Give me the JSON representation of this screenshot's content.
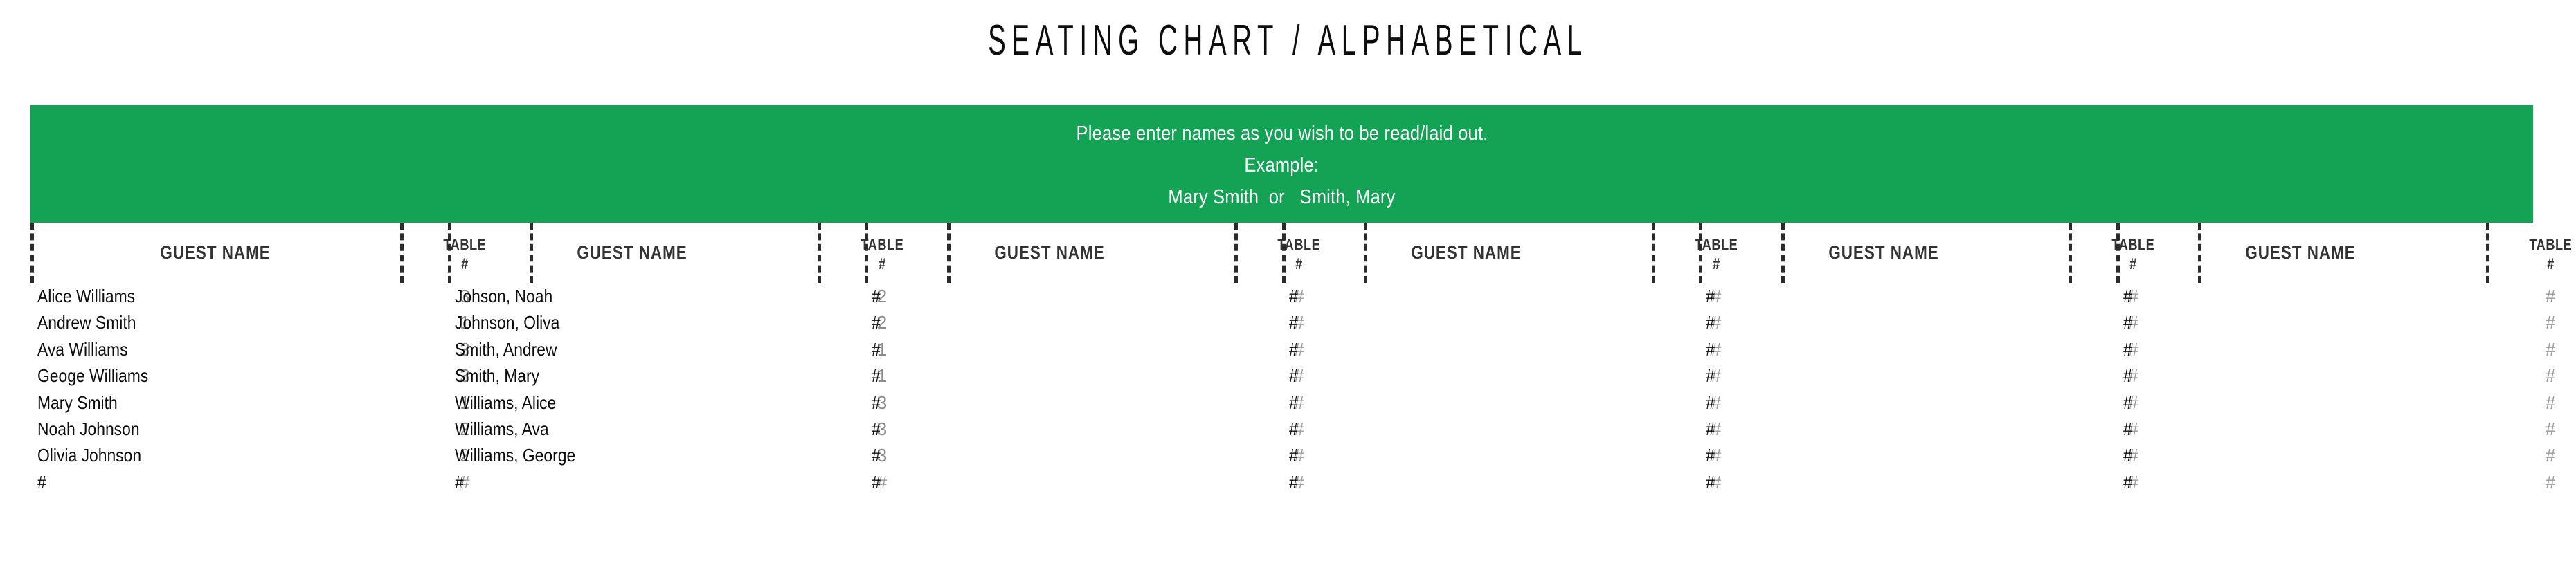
{
  "title": "SEATING CHART / ALPHABETICAL",
  "banner": {
    "background_color": "#14a254",
    "text_color": "#ffffff",
    "lines": [
      "Please enter names as you wish to be read/laid out.",
      "Example:",
      "Mary Smith  or   Smith, Mary"
    ]
  },
  "table": {
    "header": {
      "guest_name": "GUEST NAME",
      "table_line1": "TABLE",
      "table_line2": "#"
    },
    "placeholder": "#",
    "row_count": 8,
    "columns": [
      {
        "index": 1,
        "guest_name_header": "GUEST NAME",
        "table_header": "TABLE\n#",
        "rows": [
          {
            "name": "Alice Williams",
            "table": "3"
          },
          {
            "name": "Andrew Smith",
            "table": "1"
          },
          {
            "name": "Ava Williams",
            "table": "3"
          },
          {
            "name": "Geoge Williams",
            "table": "3"
          },
          {
            "name": "Mary Smith",
            "table": "1"
          },
          {
            "name": "Noah Johnson",
            "table": "2"
          },
          {
            "name": "Olivia Johnson",
            "table": "2"
          },
          {
            "name": "#",
            "table": "#"
          }
        ]
      },
      {
        "index": 2,
        "guest_name_header": "GUEST NAME",
        "table_header": "TABLE\n#",
        "rows": [
          {
            "name": "Johson, Noah",
            "table": "2"
          },
          {
            "name": "Johnson, Oliva",
            "table": "2"
          },
          {
            "name": "Smith, Andrew",
            "table": "1"
          },
          {
            "name": "Smith, Mary",
            "table": "1"
          },
          {
            "name": "Williams, Alice",
            "table": "3"
          },
          {
            "name": "Williams, Ava",
            "table": "3"
          },
          {
            "name": "Williams, George",
            "table": "3"
          },
          {
            "name": "#",
            "table": "#"
          }
        ]
      },
      {
        "index": 3,
        "guest_name_header": "GUEST NAME",
        "table_header": "TABLE\n#",
        "rows": [
          {
            "name": "#",
            "table": "#"
          },
          {
            "name": "#",
            "table": "#"
          },
          {
            "name": "#",
            "table": "#"
          },
          {
            "name": "#",
            "table": "#"
          },
          {
            "name": "#",
            "table": "#"
          },
          {
            "name": "#",
            "table": "#"
          },
          {
            "name": "#",
            "table": "#"
          },
          {
            "name": "#",
            "table": "#"
          }
        ]
      },
      {
        "index": 4,
        "guest_name_header": "GUEST NAME",
        "table_header": "TABLE\n#",
        "rows": [
          {
            "name": "#",
            "table": "#"
          },
          {
            "name": "#",
            "table": "#"
          },
          {
            "name": "#",
            "table": "#"
          },
          {
            "name": "#",
            "table": "#"
          },
          {
            "name": "#",
            "table": "#"
          },
          {
            "name": "#",
            "table": "#"
          },
          {
            "name": "#",
            "table": "#"
          },
          {
            "name": "#",
            "table": "#"
          }
        ]
      },
      {
        "index": 5,
        "guest_name_header": "GUEST NAME",
        "table_header": "TABLE\n#",
        "rows": [
          {
            "name": "#",
            "table": "#"
          },
          {
            "name": "#",
            "table": "#"
          },
          {
            "name": "#",
            "table": "#"
          },
          {
            "name": "#",
            "table": "#"
          },
          {
            "name": "#",
            "table": "#"
          },
          {
            "name": "#",
            "table": "#"
          },
          {
            "name": "#",
            "table": "#"
          },
          {
            "name": "#",
            "table": "#"
          }
        ]
      },
      {
        "index": 6,
        "guest_name_header": "GUEST NAME",
        "table_header": "TABLE\n#",
        "rows": [
          {
            "name": "#",
            "table": "#"
          },
          {
            "name": "#",
            "table": "#"
          },
          {
            "name": "#",
            "table": "#"
          },
          {
            "name": "#",
            "table": "#"
          },
          {
            "name": "#",
            "table": "#"
          },
          {
            "name": "#",
            "table": "#"
          },
          {
            "name": "#",
            "table": "#"
          },
          {
            "name": "#",
            "table": "#"
          }
        ]
      }
    ]
  }
}
